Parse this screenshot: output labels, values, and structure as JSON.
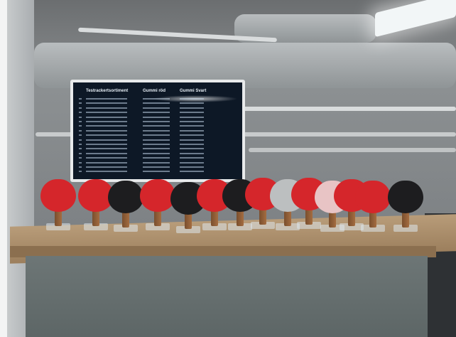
{
  "screen": {
    "col1_header": "Testrackertsortiment",
    "col2_header": "Gummi röd",
    "col3_header": "Gummi Svart"
  },
  "paddles": [
    {
      "color": "#d5262b"
    },
    {
      "color": "#d5262b"
    },
    {
      "color": "#1d1d1f"
    },
    {
      "color": "#d5262b"
    },
    {
      "color": "#1d1d1f"
    },
    {
      "color": "#d5262b"
    },
    {
      "color": "#1d1d1f"
    },
    {
      "color": "#d5262b"
    },
    {
      "color": "#bcbfc0"
    },
    {
      "color": "#d5262b"
    },
    {
      "color": "#e8c4c5"
    },
    {
      "color": "#d5262b"
    },
    {
      "color": "#d5262b"
    },
    {
      "color": "#1d1d1f"
    }
  ]
}
